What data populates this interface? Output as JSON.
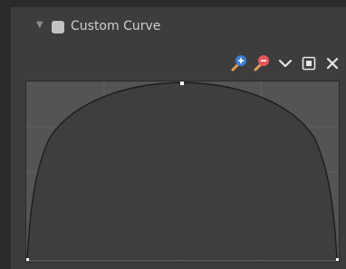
{
  "panel": {
    "title": "Custom Curve",
    "checkbox_checked": false,
    "expanded": true
  },
  "toolbar": {
    "buttons": [
      "zoom-in-icon",
      "zoom-out-icon",
      "chevron-down-icon",
      "clipping-icon",
      "close-icon"
    ]
  },
  "curve": {
    "points": [
      [
        0,
        0
      ],
      [
        0.5,
        1
      ],
      [
        1,
        0
      ]
    ],
    "colors": {
      "background": "#545454",
      "fill": "#3a3a3a",
      "line": "#1e1e1e",
      "grid": "#606060",
      "point": "#ffffff",
      "magnifier_plus": "#3d7fd6",
      "magnifier_minus": "#e8585a",
      "handle": "#e79b5a"
    }
  }
}
